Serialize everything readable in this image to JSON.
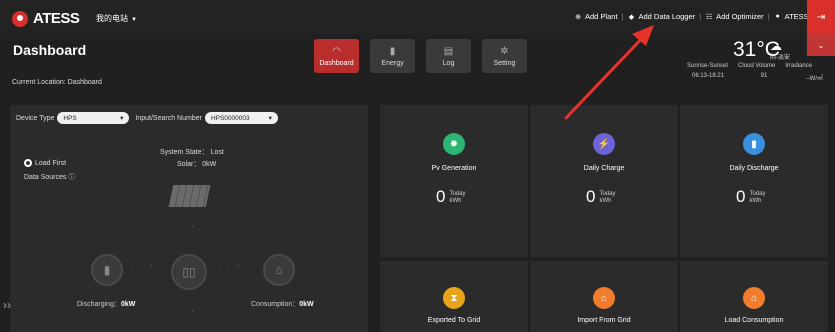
{
  "topbar": {
    "logo": "ATESS",
    "plant_name": "我的电站",
    "actions": [
      {
        "label": "Add Plant",
        "icon": "plus-circle-icon"
      },
      {
        "label": "Add Data Logger",
        "icon": "diamond-icon"
      },
      {
        "label": "Add Optimizer",
        "icon": "optimizer-icon"
      },
      {
        "label": "ATESS",
        "icon": "user-icon"
      }
    ]
  },
  "header": {
    "title": "Dashboard",
    "location": "Current Location: Dashboard",
    "nav": [
      {
        "label": "Dashboard",
        "icon": "gauge-icon",
        "active": true
      },
      {
        "label": "Energy",
        "icon": "bar-chart-icon",
        "active": false
      },
      {
        "label": "Log",
        "icon": "list-icon",
        "active": false
      },
      {
        "label": "Setting",
        "icon": "gear-icon",
        "active": false
      }
    ]
  },
  "weather": {
    "temperature": "31°C",
    "condition": "阴-淡安",
    "labels": [
      "Sunrise-Sunset",
      "Cloud Volume",
      "Irradiance"
    ],
    "values": [
      "06:13-18:21",
      "91",
      "--W/㎡"
    ]
  },
  "filters": {
    "device_type_label": "Device Type",
    "device_type_value": "HPS",
    "search_label": "Input/Search Number",
    "search_value": "HPS0000003"
  },
  "system": {
    "load_first": "Load First",
    "data_sources": "Data Sources ⓘ",
    "system_state": "System State： Lost",
    "solar": "Solar： 0kW",
    "discharging_label": "Discharging：",
    "discharging_value": "0kW",
    "consumption_label": "Consumption：",
    "consumption_value": "0kW"
  },
  "cards": [
    {
      "title": "Pv Generation",
      "value": "0",
      "today": "Today",
      "unit": "kWh",
      "color": "#2bb673",
      "icon": "sun-icon"
    },
    {
      "title": "Daily Charge",
      "value": "0",
      "today": "Today",
      "unit": "kWh",
      "color": "#6c63d9",
      "icon": "battery-charge-icon"
    },
    {
      "title": "Daily Discharge",
      "value": "0",
      "today": "Today",
      "unit": "kWh",
      "color": "#3b8fe0",
      "icon": "battery-discharge-icon"
    },
    {
      "title": "Exported To Grid",
      "value": "",
      "today": "",
      "unit": "",
      "color": "#e8a418",
      "icon": "hourglass-icon"
    },
    {
      "title": "Import From Grid",
      "value": "",
      "today": "",
      "unit": "",
      "color": "#ef7d2c",
      "icon": "home-icon"
    },
    {
      "title": "Load Consumption",
      "value": "",
      "today": "",
      "unit": "",
      "color": "#ef7d2c",
      "icon": "home-icon"
    }
  ],
  "colors": {
    "accent": "#b92e2c",
    "background": "#202020",
    "panel": "#2b2b2b",
    "annotation_arrow": "#e8322c"
  }
}
